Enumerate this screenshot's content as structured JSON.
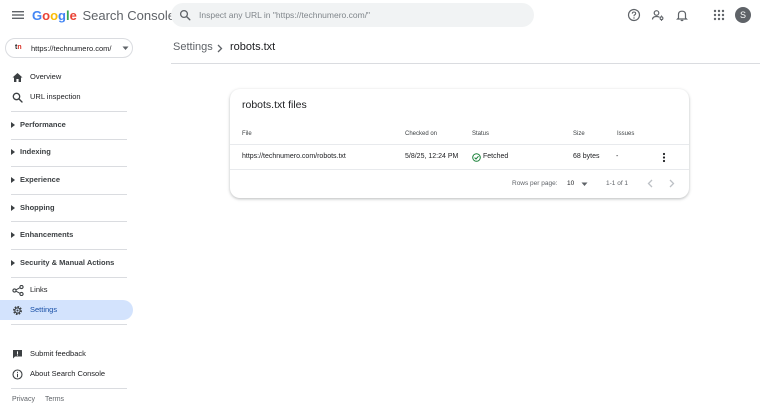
{
  "header": {
    "logo_letters": [
      {
        "ch": "G",
        "color": "#4285f4"
      },
      {
        "ch": "o",
        "color": "#ea4335"
      },
      {
        "ch": "o",
        "color": "#fbbc05"
      },
      {
        "ch": "g",
        "color": "#4285f4"
      },
      {
        "ch": "l",
        "color": "#34a853"
      },
      {
        "ch": "e",
        "color": "#ea4335"
      }
    ],
    "product": "Search Console",
    "search_placeholder": "Inspect any URL in \"https://technumero.com/\"",
    "avatar_letter": "S",
    "icons": [
      "menu-icon",
      "search-icon",
      "help-icon",
      "manage-users-icon",
      "bell-icon",
      "apps-icon"
    ]
  },
  "property": {
    "favicon_t": "t",
    "favicon_n": "n",
    "url": "https://technumero.com/"
  },
  "sidebar": {
    "overview": "Overview",
    "url_inspection": "URL inspection",
    "sections": [
      "Performance",
      "Indexing",
      "Experience",
      "Shopping",
      "Enhancements",
      "Security & Manual Actions"
    ],
    "links": "Links",
    "settings": "Settings",
    "submit_feedback": "Submit feedback",
    "about": "About Search Console",
    "footer": {
      "privacy": "Privacy",
      "terms": "Terms"
    }
  },
  "breadcrumb": {
    "parent": "Settings",
    "current": "robots.txt"
  },
  "card": {
    "title": "robots.txt files",
    "columns": {
      "file": "File",
      "checked_on": "Checked on",
      "status": "Status",
      "size": "Size",
      "issues": "Issues"
    },
    "rows": [
      {
        "file": "https://technumero.com/robots.txt",
        "checked_on": "5/8/25, 12:24 PM",
        "status": "Fetched",
        "size": "68 bytes",
        "issues": "-"
      }
    ],
    "pagination": {
      "rows_per_page_label": "Rows per page:",
      "rows_per_page": "10",
      "range": "1-1 of 1"
    }
  },
  "colors": {
    "accent": "#1a73e8",
    "active_bg": "#d3e3fd",
    "success": "#188038"
  }
}
